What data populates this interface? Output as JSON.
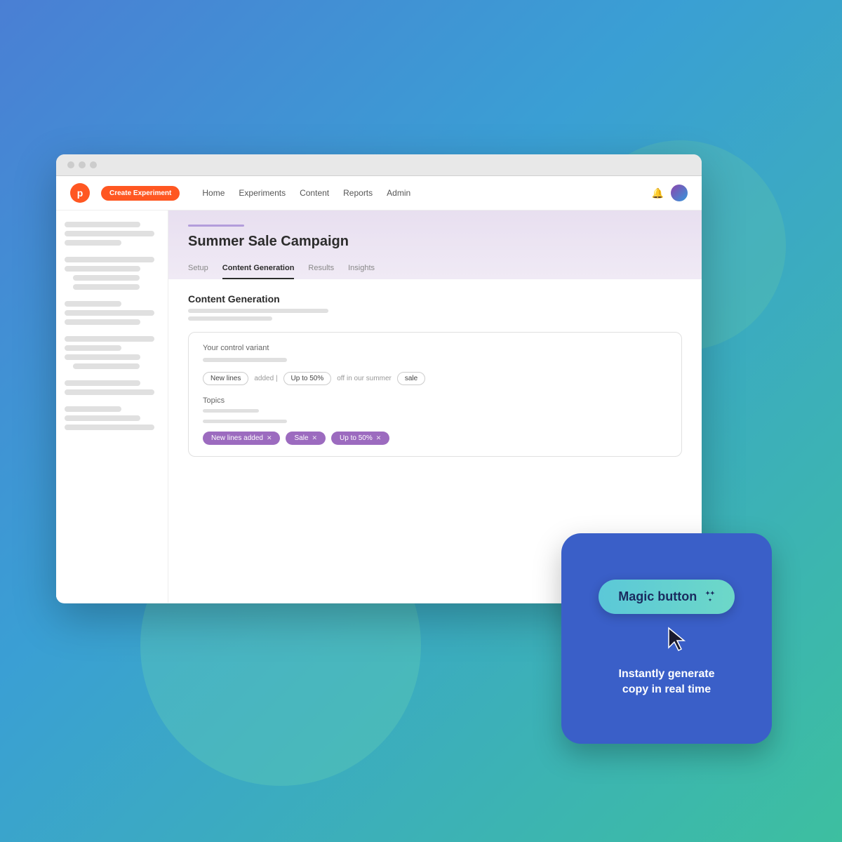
{
  "background": {
    "gradient_start": "#4a7fd4",
    "gradient_end": "#3dbfa0"
  },
  "browser": {
    "dots": [
      "dot1",
      "dot2",
      "dot3"
    ]
  },
  "navbar": {
    "logo_letter": "p",
    "create_button_label": "Create Experiment",
    "nav_links": [
      {
        "label": "Home",
        "id": "home"
      },
      {
        "label": "Experiments",
        "id": "experiments"
      },
      {
        "label": "Content",
        "id": "content"
      },
      {
        "label": "Reports",
        "id": "reports"
      },
      {
        "label": "Admin",
        "id": "admin"
      }
    ]
  },
  "campaign": {
    "title": "Summer Sale Campaign",
    "tabs": [
      {
        "label": "Setup",
        "id": "setup",
        "active": false
      },
      {
        "label": "Content Generation",
        "id": "content-generation",
        "active": true
      },
      {
        "label": "Results",
        "id": "results",
        "active": false
      },
      {
        "label": "Insights",
        "id": "insights",
        "active": false
      }
    ]
  },
  "content_generation": {
    "section_title": "Content Generation",
    "control_variant_label": "Your control variant",
    "tags": [
      {
        "label": "New lines",
        "id": "tag-new-lines"
      },
      {
        "label": "added |",
        "id": "tag-added",
        "is_separator": true
      },
      {
        "label": "Up to 50%",
        "id": "tag-up-to-50"
      },
      {
        "label": "off in our summer",
        "id": "tag-off-summer",
        "is_separator": true
      },
      {
        "label": "sale",
        "id": "tag-sale"
      }
    ],
    "topics_label": "Topics",
    "pill_tags": [
      {
        "label": "New lines added",
        "id": "pill-new-lines-added"
      },
      {
        "label": "Sale",
        "id": "pill-sale"
      },
      {
        "label": "Up to 50%",
        "id": "pill-up-to-50"
      }
    ]
  },
  "magic_card": {
    "button_label": "Magic button",
    "description_line1": "Instantly generate",
    "description_line2": "copy in real time"
  }
}
